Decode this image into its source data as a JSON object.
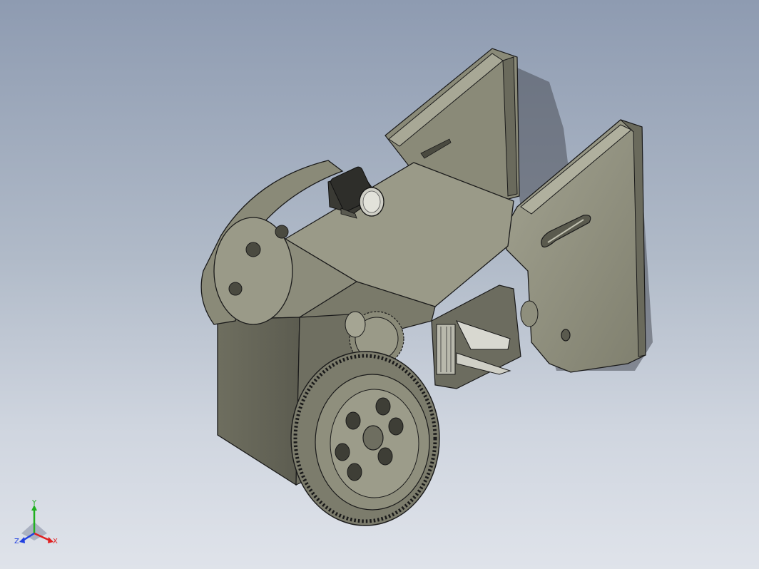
{
  "viewport": {
    "background_top": "#8e9bb1",
    "background_bottom": "#dfe3ea",
    "part_color": "#8f8f7d",
    "edge_color": "#1a1a1a"
  },
  "triad": {
    "x_label": "X",
    "y_label": "Y",
    "z_label": "Z",
    "x_color": "#e02020",
    "y_color": "#20b020",
    "z_color": "#2040e0"
  }
}
